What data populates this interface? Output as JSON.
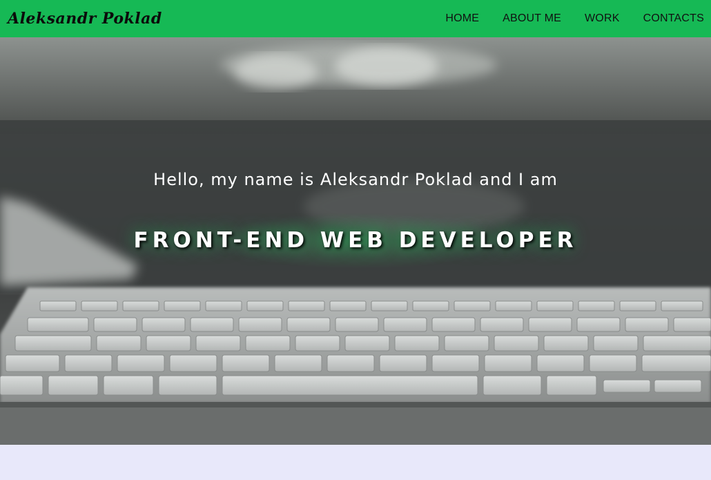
{
  "brand": {
    "logo_text": "Aleksandr Poklad"
  },
  "nav": {
    "items": [
      {
        "label": "HOME"
      },
      {
        "label": "ABOUT ME"
      },
      {
        "label": "WORK"
      },
      {
        "label": "CONTACTS"
      }
    ]
  },
  "hero": {
    "greeting": "Hello, my name is Aleksandr Poklad and I am",
    "role": "FRONT-END WEB DEVELOPER",
    "background_image": "keyboard-photo"
  },
  "colors": {
    "navbar": "#16b955",
    "page_background": "#e8e8fa",
    "hero_text": "#ffffff"
  }
}
